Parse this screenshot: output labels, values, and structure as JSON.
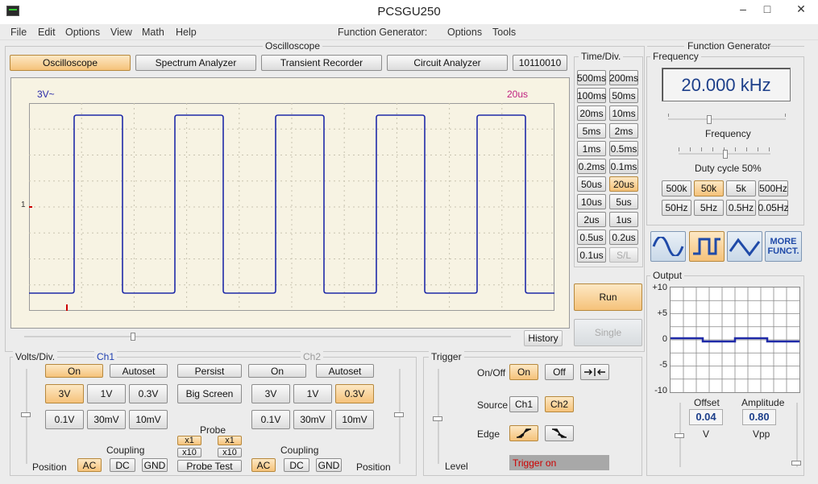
{
  "app": {
    "title": "PCSGU250"
  },
  "menu": {
    "file": "File",
    "edit": "Edit",
    "options": "Options",
    "view": "View",
    "math": "Math",
    "help": "Help",
    "fg_label": "Function Generator:",
    "fg_options": "Options",
    "fg_tools": "Tools"
  },
  "osc": {
    "group_title": "Oscilloscope",
    "tabs": [
      "Oscilloscope",
      "Spectrum Analyzer",
      "Transient Recorder",
      "Circuit Analyzer",
      "10110010"
    ],
    "screen_volt": "3V~",
    "screen_time": "20us",
    "marker_label": "1",
    "history": "History"
  },
  "timediv": {
    "title": "Time/Div.",
    "buttons": [
      "500ms",
      "200ms",
      "100ms",
      "50ms",
      "20ms",
      "10ms",
      "5ms",
      "2ms",
      "1ms",
      "0.5ms",
      "0.2ms",
      "0.1ms",
      "50us",
      "20us",
      "10us",
      "5us",
      "2us",
      "1us",
      "0.5us",
      "0.2us",
      "0.1us",
      "S/L"
    ],
    "selected": "20us",
    "run": "Run",
    "single": "Single"
  },
  "volts": {
    "title": "Volts/Div.",
    "ch1_title": "Ch1",
    "ch2_title": "Ch2",
    "on": "On",
    "autoset": "Autoset",
    "persist": "Persist",
    "big_screen": "Big Screen",
    "ranges_row1": [
      "3V",
      "1V",
      "0.3V"
    ],
    "ranges_row2": [
      "0.1V",
      "30mV",
      "10mV"
    ],
    "ch1_selected": "3V",
    "ch2_selected": "0.3V",
    "probe": "Probe",
    "x1": "x1",
    "x10": "x10",
    "probe_test": "Probe Test",
    "coupling": "Coupling",
    "ac": "AC",
    "dc": "DC",
    "gnd": "GND",
    "position": "Position"
  },
  "trigger": {
    "title": "Trigger",
    "onoff": "On/Off",
    "on": "On",
    "off": "Off",
    "source": "Source",
    "ch1": "Ch1",
    "ch2": "Ch2",
    "edge": "Edge",
    "level": "Level",
    "status": "Trigger on"
  },
  "fgen": {
    "title": "Function Generator",
    "freq_group": "Frequency",
    "display": "20.000 kHz",
    "freq_label": "Frequency",
    "duty_label": "Duty cycle 50%",
    "range_row1": [
      "500k",
      "50k",
      "5k",
      "500Hz"
    ],
    "range_row2": [
      "50Hz",
      "5Hz",
      "0.5Hz",
      "0.05Hz"
    ],
    "range_selected": "50k",
    "more": [
      "MORE",
      "FUNCT."
    ],
    "output_title": "Output",
    "y_ticks": [
      "+10",
      "+5",
      "0",
      "-5",
      "-10"
    ],
    "offset_label": "Offset",
    "offset_value": "0.04",
    "offset_unit": "V",
    "amplitude_label": "Amplitude",
    "amplitude_value": "0.80",
    "amplitude_unit": "Vpp"
  },
  "colors": {
    "trace": "#1f2aa8",
    "screen_bg": "#f7f3e3",
    "accent": "#f5c27a",
    "trigger_status": "#cc0000"
  }
}
